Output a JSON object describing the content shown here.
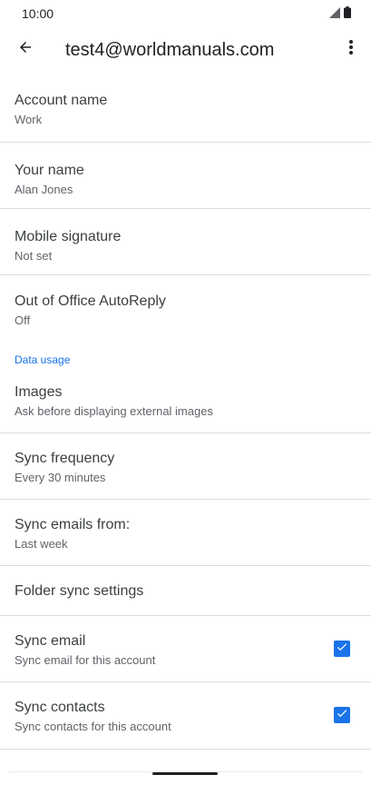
{
  "status": {
    "time": "10:00"
  },
  "app_bar": {
    "title": "test4@worldmanuals.com"
  },
  "prefs": {
    "account_name": {
      "title": "Account name",
      "summary": "Work"
    },
    "your_name": {
      "title": "Your name",
      "summary": "Alan Jones"
    },
    "mobile_signature": {
      "title": "Mobile signature",
      "summary": "Not set"
    },
    "out_of_office": {
      "title": "Out of Office AutoReply",
      "summary": "Off"
    },
    "data_usage_category": "Data usage",
    "images": {
      "title": "Images",
      "summary": "Ask before displaying external images"
    },
    "sync_frequency": {
      "title": "Sync frequency",
      "summary": "Every 30 minutes"
    },
    "sync_emails_from": {
      "title": "Sync emails from:",
      "summary": "Last week"
    },
    "folder_sync": {
      "title": "Folder sync settings"
    },
    "sync_email": {
      "title": "Sync email",
      "summary": "Sync email for this account",
      "checked": true
    },
    "sync_contacts": {
      "title": "Sync contacts",
      "summary": "Sync contacts for this account",
      "checked": true
    }
  },
  "colors": {
    "accent": "#1a73e8",
    "divider": "#dadce0",
    "text_primary": "#3c4043",
    "text_secondary": "#5f6368"
  },
  "icons": [
    "signal-icon",
    "battery-icon",
    "back-arrow-icon",
    "more-vert-icon",
    "checkbox-checked-icon"
  ]
}
